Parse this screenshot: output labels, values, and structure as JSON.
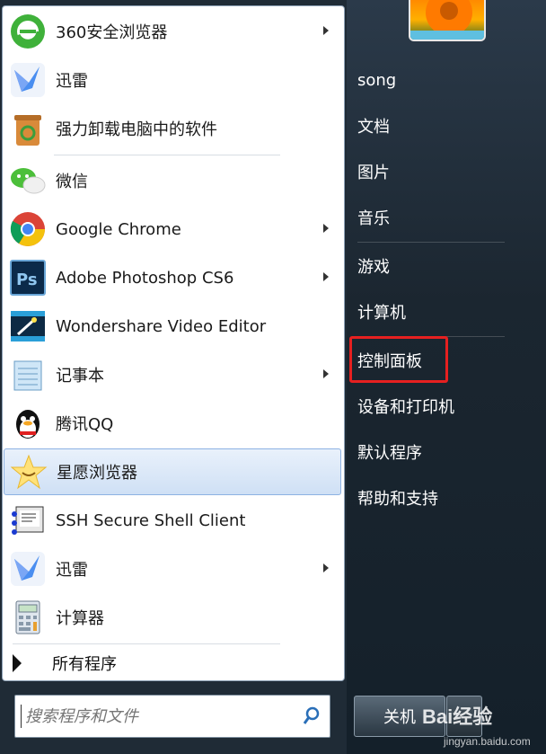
{
  "programs": [
    {
      "label": "360安全浏览器",
      "icon": "360-browser-icon",
      "has_submenu": true
    },
    {
      "label": "迅雷",
      "icon": "thunder-icon",
      "has_submenu": false
    },
    {
      "label": "强力卸载电脑中的软件",
      "icon": "uninstall-icon",
      "has_submenu": false
    },
    {
      "label": "微信",
      "icon": "wechat-icon",
      "has_submenu": false
    },
    {
      "label": "Google Chrome",
      "icon": "chrome-icon",
      "has_submenu": true
    },
    {
      "label": "Adobe Photoshop CS6",
      "icon": "photoshop-icon",
      "has_submenu": true
    },
    {
      "label": "Wondershare Video Editor",
      "icon": "video-editor-icon",
      "has_submenu": false
    },
    {
      "label": "记事本",
      "icon": "notepad-icon",
      "has_submenu": true
    },
    {
      "label": "腾讯QQ",
      "icon": "qq-icon",
      "has_submenu": false
    },
    {
      "label": "星愿浏览器",
      "icon": "star-browser-icon",
      "has_submenu": false,
      "selected": true
    },
    {
      "label": "SSH Secure Shell Client",
      "icon": "ssh-icon",
      "has_submenu": false
    },
    {
      "label": "迅雷",
      "icon": "thunder-icon",
      "has_submenu": true
    },
    {
      "label": "计算器",
      "icon": "calculator-icon",
      "has_submenu": false
    }
  ],
  "all_programs_label": "所有程序",
  "search": {
    "placeholder": "搜索程序和文件"
  },
  "right_items": [
    "song",
    "文档",
    "图片",
    "音乐",
    "游戏",
    "计算机",
    "控制面板",
    "设备和打印机",
    "默认程序",
    "帮助和支持"
  ],
  "highlighted_item": "控制面板",
  "shutdown_label": "关机",
  "watermark": {
    "brand": "Bai经验",
    "url": "jingyan.baidu.com"
  },
  "colors": {
    "highlight_border": "#e62020",
    "selected_bg": "#cfe0f5",
    "panel_dark": "#1f2b36"
  }
}
